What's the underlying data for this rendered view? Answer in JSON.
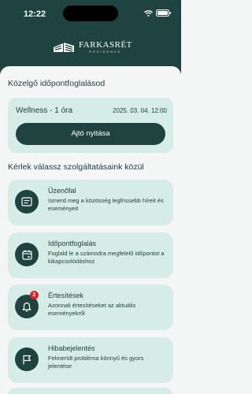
{
  "status_bar": {
    "time": "12:22"
  },
  "brand": {
    "name": "FARKASRÉT",
    "sub": "RESIDENCE"
  },
  "upcoming": {
    "section_title": "Közelgő időpontfoglalásod",
    "service": "Wellness - 1 óra",
    "datetime": "2025. 03. 04. 12:00",
    "door_button": "Ajtó nyitása"
  },
  "services": {
    "section_title": "Kérlek válassz szolgáltatásaink közül",
    "items": [
      {
        "title": "Üzenőfal",
        "desc": "Ismerd meg a közösség legfrissebb híreit és eseményeit",
        "icon": "message-board-icon"
      },
      {
        "title": "Időpontfoglalás",
        "desc": "Foglald le a számodra megfelelő időpontot a kikapcsolódáshoz",
        "icon": "calendar-icon"
      },
      {
        "title": "Értesítések",
        "desc": "Azonnali értesítéseket az aktuális eseményekről",
        "icon": "bell-icon",
        "badge": "2"
      },
      {
        "title": "Hibabejelentés",
        "desc": "Felmerült probléma könnyű és gyors jelentése",
        "icon": "flag-icon"
      }
    ]
  },
  "colors": {
    "header": "#1e4340",
    "card": "#d6ede7",
    "badge": "#d8242b"
  }
}
